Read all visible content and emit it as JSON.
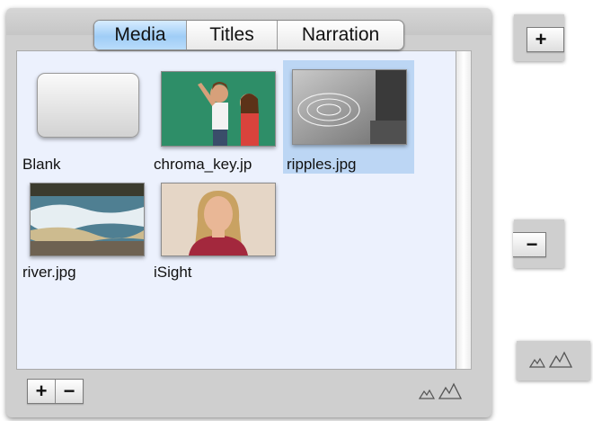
{
  "tabs": [
    {
      "label": "Media",
      "active": true
    },
    {
      "label": "Titles",
      "active": false
    },
    {
      "label": "Narration",
      "active": false
    }
  ],
  "media": [
    {
      "label": "Blank",
      "thumb": "blank"
    },
    {
      "label": "chroma_key.jp",
      "thumb": "chroma"
    },
    {
      "label": "ripples.jpg",
      "thumb": "ripples",
      "selected": true
    },
    {
      "label": "river.jpg",
      "thumb": "river"
    },
    {
      "label": "iSight",
      "thumb": "isight"
    }
  ],
  "buttons": {
    "add": "+",
    "remove": "−"
  },
  "icons": {
    "zoom_small": "small-mountain-icon",
    "zoom_large": "large-mountain-icon"
  },
  "colors": {
    "selection": "#bcd6f4",
    "content_bg": "#ecf1fd",
    "tab_active": "#9fcdf6"
  }
}
